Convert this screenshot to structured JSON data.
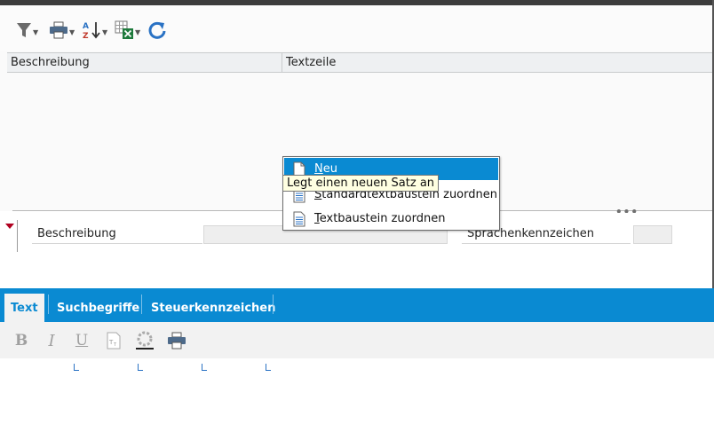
{
  "toolbar": {
    "buttons": [
      {
        "name": "filter-icon",
        "has_dropdown": true
      },
      {
        "name": "print-icon",
        "has_dropdown": true
      },
      {
        "name": "sort-icon",
        "has_dropdown": true
      },
      {
        "name": "excel-export-icon",
        "has_dropdown": true
      },
      {
        "name": "refresh-icon",
        "has_dropdown": false
      }
    ]
  },
  "grid": {
    "columns": [
      "Beschreibung",
      "Textzeile"
    ],
    "rows": []
  },
  "detail": {
    "beschreibung_label": "Beschreibung",
    "beschreibung_value": "",
    "sprache_label": "Sprachenkennzeichen",
    "sprache_value": ""
  },
  "tabs": [
    {
      "label": "Text",
      "active": true
    },
    {
      "label": "Suchbegriffe",
      "active": false
    },
    {
      "label": "Steuerkennzeichen",
      "active": false
    }
  ],
  "editor": {
    "tools": [
      "bold-icon",
      "italic-icon",
      "underline-icon",
      "text-size-icon",
      "color-icon",
      "print-icon"
    ],
    "bold_glyph": "B",
    "italic_glyph": "I",
    "underline_glyph": "U"
  },
  "context_menu": {
    "items": [
      {
        "pre": "",
        "mnemonic": "N",
        "post": "eu",
        "highlighted": true
      },
      {
        "pre": "",
        "mnemonic": "S",
        "post": "tandardtextbaustein zuordnen",
        "highlighted": false
      },
      {
        "pre": "",
        "mnemonic": "T",
        "post": "extbaustein zuordnen",
        "highlighted": false
      }
    ],
    "tooltip": "Legt einen neuen Satz an"
  },
  "colors": {
    "accent": "#0a8ad2",
    "marker": "#b00020",
    "tooltip_bg": "#ffffe1"
  }
}
